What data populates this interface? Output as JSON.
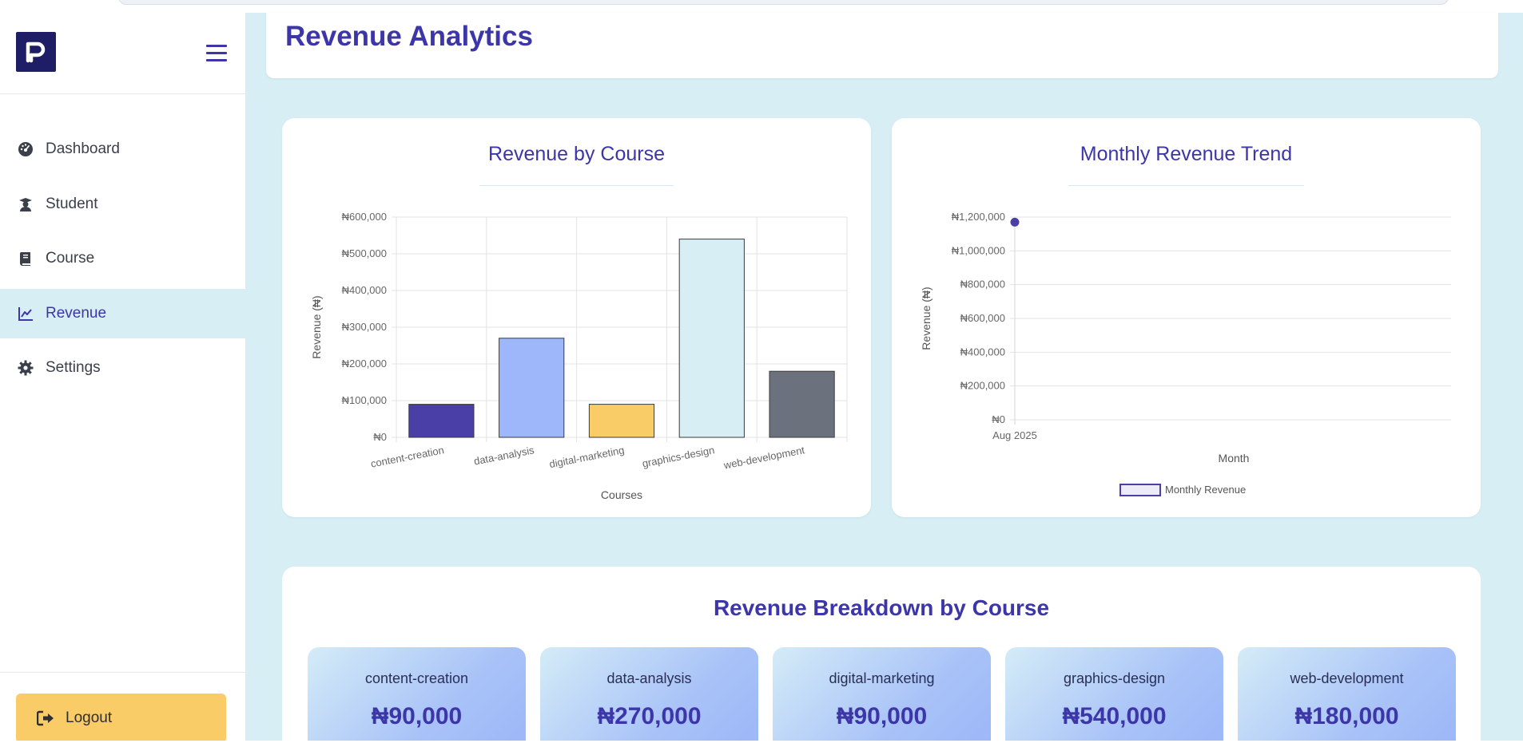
{
  "sidebar": {
    "logo_letter": "P",
    "nav": [
      {
        "label": "Dashboard",
        "icon": "dashboard-gauge-icon",
        "active": false
      },
      {
        "label": "Student",
        "icon": "student-icon",
        "active": false
      },
      {
        "label": "Course",
        "icon": "book-icon",
        "active": false
      },
      {
        "label": "Revenue",
        "icon": "chart-line-icon",
        "active": true
      },
      {
        "label": "Settings",
        "icon": "gear-icon",
        "active": false
      }
    ],
    "logout_label": "Logout"
  },
  "header": {
    "title": "Revenue Analytics"
  },
  "colors": {
    "accent": "#3c36a8",
    "page_bg": "#d7eef5",
    "logout_bg": "#f9cc67",
    "logo_bg": "#1f1d66"
  },
  "chart_data": [
    {
      "type": "bar",
      "title": "Revenue by Course",
      "xlabel": "Courses",
      "ylabel": "Revenue (₦)",
      "ylim": [
        0,
        600000
      ],
      "yticks": [
        "₦0",
        "₦100,000",
        "₦200,000",
        "₦300,000",
        "₦400,000",
        "₦500,000",
        "₦600,000"
      ],
      "categories": [
        "content-creation",
        "data-analysis",
        "digital-marketing",
        "graphics-design",
        "web-development"
      ],
      "values": [
        90000,
        270000,
        90000,
        540000,
        180000
      ],
      "colors": [
        "#4a3fa6",
        "#9db7fa",
        "#f9cc67",
        "#d7eef5",
        "#6b727d"
      ],
      "grid": true
    },
    {
      "type": "line",
      "title": "Monthly Revenue Trend",
      "xlabel": "Month",
      "ylabel": "Revenue (₦)",
      "ylim": [
        0,
        1200000
      ],
      "yticks": [
        "₦0",
        "₦200,000",
        "₦400,000",
        "₦600,000",
        "₦800,000",
        "₦1,000,000",
        "₦1,200,000"
      ],
      "x": [
        "Aug 2025"
      ],
      "series": [
        {
          "name": "Monthly Revenue",
          "values": [
            1170000
          ]
        }
      ],
      "legend": "bottom",
      "grid": true
    }
  ],
  "breakdown": {
    "title": "Revenue Breakdown by Course",
    "items": [
      {
        "name": "content-creation",
        "amount": "₦90,000"
      },
      {
        "name": "data-analysis",
        "amount": "₦270,000"
      },
      {
        "name": "digital-marketing",
        "amount": "₦90,000"
      },
      {
        "name": "graphics-design",
        "amount": "₦540,000"
      },
      {
        "name": "web-development",
        "amount": "₦180,000"
      }
    ]
  }
}
